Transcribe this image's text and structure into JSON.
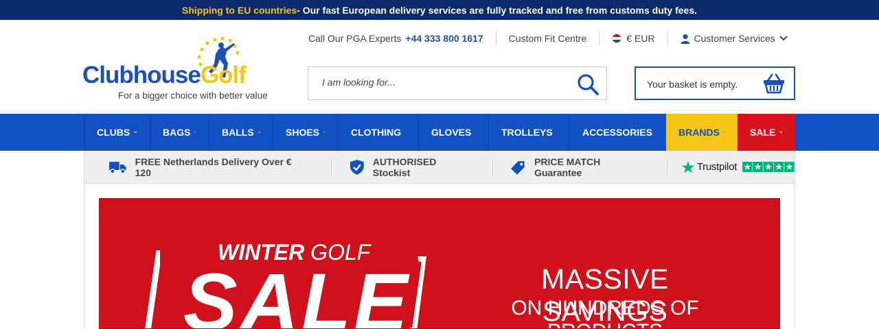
{
  "topbar": {
    "highlight": "Shipping to EU countries",
    "message": " - Our fast European delivery services are fully tracked and free from customs duty fees."
  },
  "logo": {
    "brand_part1": "Clubhouse",
    "brand_part2": "Golf",
    "tagline": "For a bigger choice with better value"
  },
  "utility": {
    "call_label": "Call Our PGA Experts",
    "phone": "+44 333 800 1617",
    "custom_fit": "Custom Fit Centre",
    "currency": "€ EUR",
    "customer_services": "Customer Services"
  },
  "search": {
    "placeholder": "I am looking for..."
  },
  "basket": {
    "status": "Your basket is empty."
  },
  "nav": {
    "items": [
      {
        "label": "CLUBS"
      },
      {
        "label": "BAGS"
      },
      {
        "label": "BALLS"
      },
      {
        "label": "SHOES"
      },
      {
        "label": "CLOTHING"
      },
      {
        "label": "GLOVES"
      },
      {
        "label": "TROLLEYS"
      },
      {
        "label": "ACCESSORIES"
      },
      {
        "label": "BRANDS"
      },
      {
        "label": "SALE"
      }
    ]
  },
  "benefits": {
    "delivery": "FREE Netherlands Delivery Over € 120",
    "stockist": "AUTHORISED Stockist",
    "price_match": "PRICE MATCH Guarantee",
    "trustpilot": "Trustpilot"
  },
  "hero": {
    "kicker_bold": "WINTER",
    "kicker_rest": " GOLF",
    "big": "SALE",
    "headline": "MASSIVE SAVINGS",
    "subheadline": "ON HUNDREDS OF PRODUCTS"
  },
  "colors": {
    "primary_blue": "#1151c4",
    "navy": "#0a2a6b",
    "accent_yellow": "#f5c518",
    "sale_red": "#d8131b",
    "trustpilot_green": "#00b67a"
  }
}
